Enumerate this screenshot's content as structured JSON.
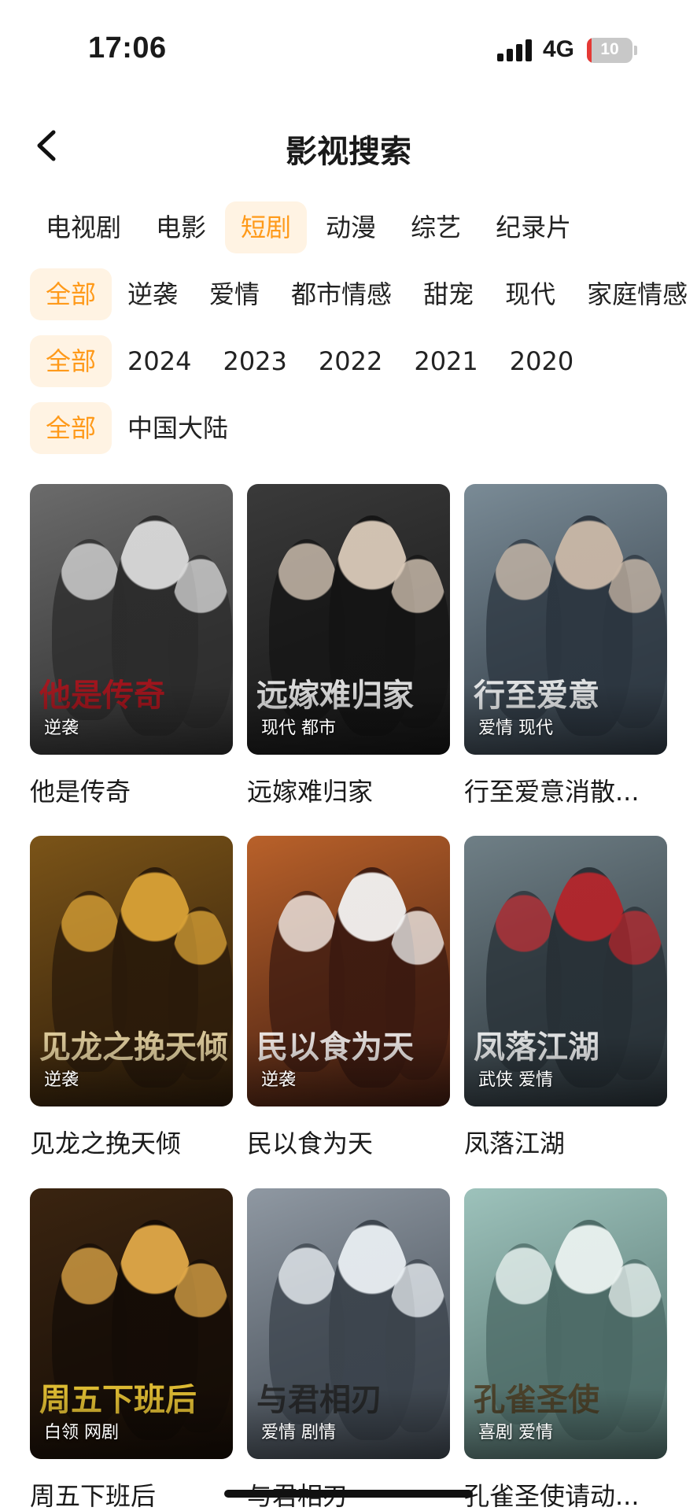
{
  "status": {
    "time": "17:06",
    "network": "4G",
    "battery": "10",
    "battery_level": 0.1
  },
  "nav": {
    "title": "影视搜索"
  },
  "categories": [
    "电视剧",
    "电影",
    "短剧",
    "动漫",
    "综艺",
    "纪录片"
  ],
  "categories_active": 2,
  "genre_filter": [
    "全部",
    "逆袭",
    "爱情",
    "都市情感",
    "甜宠",
    "现代",
    "家庭情感"
  ],
  "year_filter": [
    "全部",
    "2024",
    "2023",
    "2022",
    "2021",
    "2020"
  ],
  "region_filter": [
    "全部",
    "中国大陆"
  ],
  "colors": {
    "accent": "#ff9a1a",
    "accent_bg": "#fff3e3"
  },
  "items": [
    {
      "title": "他是传奇",
      "tags": "逆袭",
      "poster_text": "他是传奇",
      "palette": [
        "#6b6b6b",
        "#2b2b2b",
        "#d9d9d9"
      ],
      "deco_color": "#b3121b"
    },
    {
      "title": "远嫁难归家",
      "tags": "现代 都市",
      "poster_text": "远嫁难归家",
      "palette": [
        "#3a3a3a",
        "#141414",
        "#d9c9b8"
      ],
      "deco_color": "#ffffff"
    },
    {
      "title": "行至爱意消散...",
      "tags": "爱情 现代",
      "poster_text": "行至爱意",
      "palette": [
        "#7a8b96",
        "#2c3640",
        "#c9b7a6"
      ],
      "deco_color": "#ffffff"
    },
    {
      "title": "见龙之挽天倾",
      "tags": "逆袭",
      "poster_text": "见龙之挽天倾",
      "palette": [
        "#7b5418",
        "#2a1a0a",
        "#d8a136"
      ],
      "deco_color": "#f5e3b0"
    },
    {
      "title": "民以食为天",
      "tags": "逆袭",
      "poster_text": "民以食为天",
      "palette": [
        "#b9612a",
        "#3c1a10",
        "#f1f1f1"
      ],
      "deco_color": "#ffffff"
    },
    {
      "title": "凤落江湖",
      "tags": "武侠 爱情",
      "poster_text": "凤落江湖",
      "palette": [
        "#6f7f86",
        "#273036",
        "#b3242a"
      ],
      "deco_color": "#ffffff"
    },
    {
      "title": "周五下班后",
      "tags": "白领 网剧",
      "poster_text": "周五下班后",
      "palette": [
        "#3a2410",
        "#140c06",
        "#e0a848"
      ],
      "deco_color": "#ffd83a"
    },
    {
      "title": "与君相刃",
      "tags": "爱情 剧情",
      "poster_text": "与君相刃",
      "palette": [
        "#8f98a2",
        "#3b434c",
        "#e8edf1"
      ],
      "deco_color": "#222222"
    },
    {
      "title": "孔雀圣使请动...",
      "tags": "喜剧 爱情",
      "poster_text": "孔雀圣使",
      "palette": [
        "#9dc2bb",
        "#4c6a66",
        "#e9f1ef"
      ],
      "deco_color": "#4a3a20"
    }
  ]
}
